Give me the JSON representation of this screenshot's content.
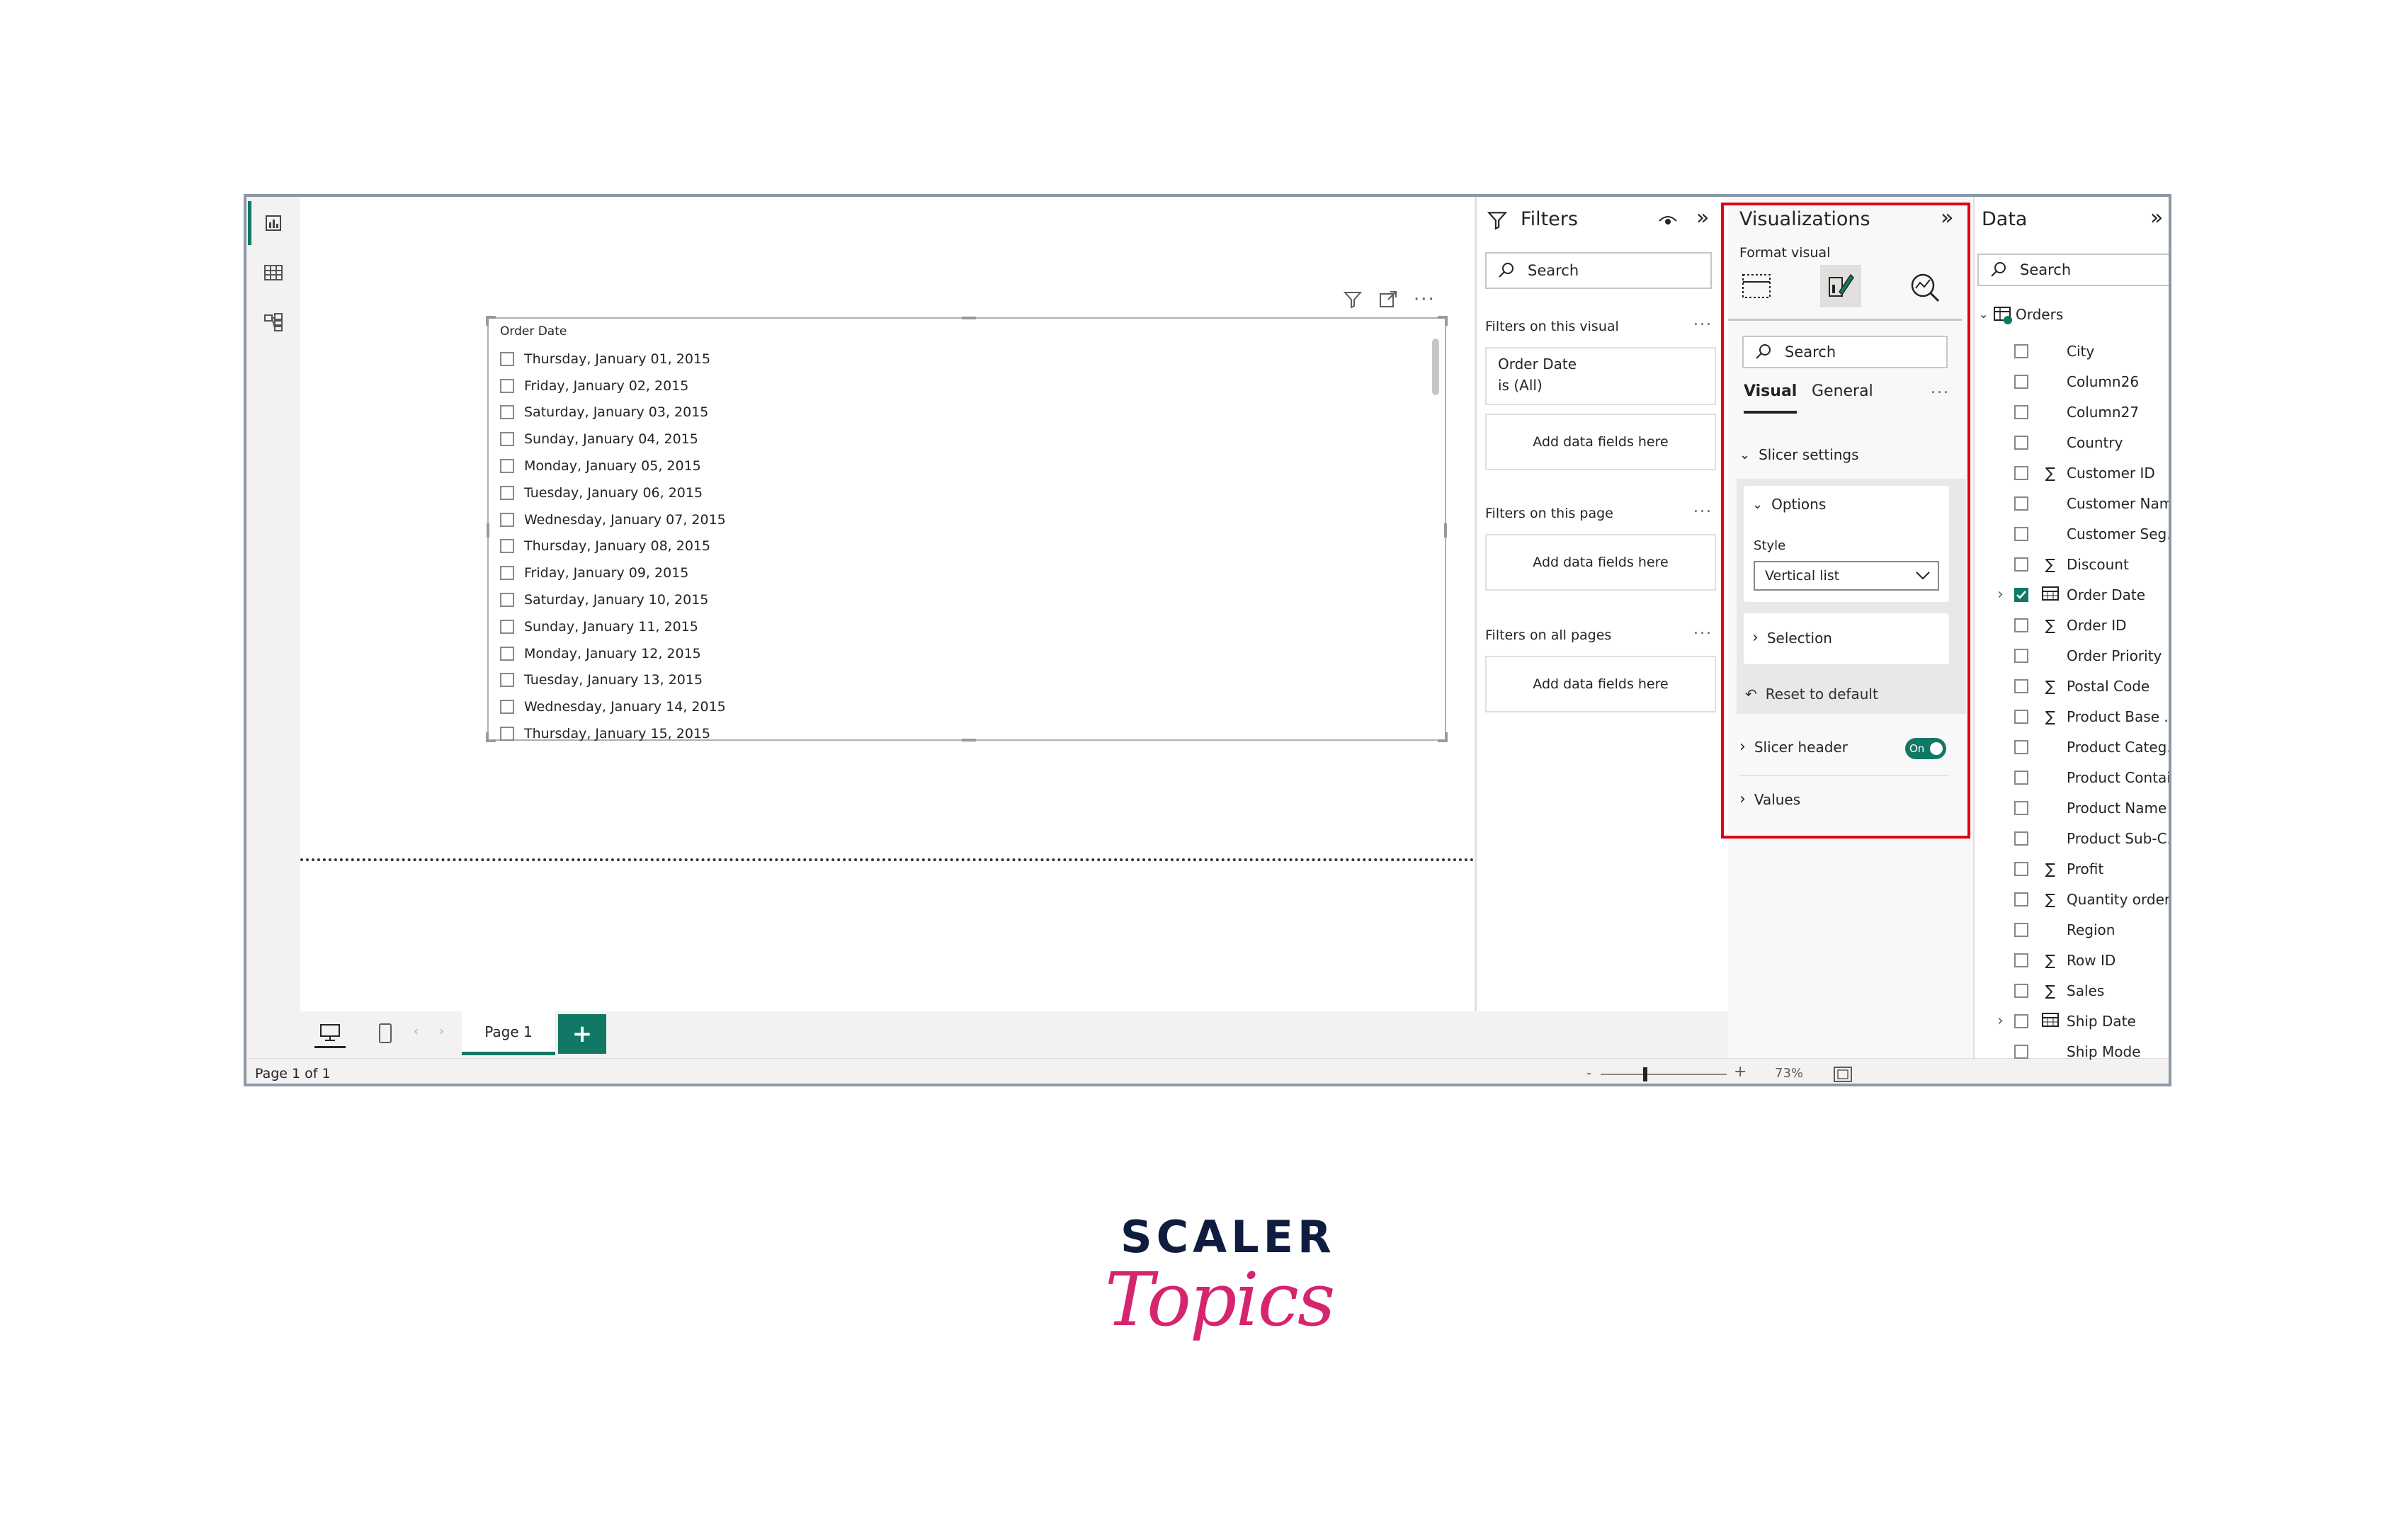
{
  "left_rail": {
    "items": [
      {
        "icon": "report-view-icon"
      },
      {
        "icon": "table-view-icon"
      },
      {
        "icon": "model-view-icon"
      }
    ]
  },
  "slicer": {
    "title": "Order Date",
    "items": [
      "Thursday, January 01, 2015",
      "Friday, January 02, 2015",
      "Saturday, January 03, 2015",
      "Sunday, January 04, 2015",
      "Monday, January 05, 2015",
      "Tuesday, January 06, 2015",
      "Wednesday, January 07, 2015",
      "Thursday, January 08, 2015",
      "Friday, January 09, 2015",
      "Saturday, January 10, 2015",
      "Sunday, January 11, 2015",
      "Monday, January 12, 2015",
      "Tuesday, January 13, 2015",
      "Wednesday, January 14, 2015",
      "Thursday, January 15, 2015"
    ]
  },
  "page_tabs": {
    "page_label": "Page 1",
    "add_label": "+"
  },
  "status_bar": {
    "page_count": "Page 1 of 1",
    "zoom_minus": "-",
    "zoom_plus": "+",
    "zoom_value": "73%"
  },
  "filters": {
    "title": "Filters",
    "search_placeholder": "Search",
    "on_this_visual": "Filters on this visual",
    "order_date_filter_title": "Order Date",
    "order_date_filter_value": "is (All)",
    "add_data_fields": "Add data fields here",
    "on_this_page": "Filters on this page",
    "on_all_pages": "Filters on all pages",
    "more": "..."
  },
  "visualizations": {
    "title": "Visualizations",
    "format_visual": "Format visual",
    "search_placeholder": "Search",
    "tab_visual": "Visual",
    "tab_general": "General",
    "more": "...",
    "slicer_settings": "Slicer settings",
    "options": "Options",
    "style_label": "Style",
    "style_value": "Vertical list",
    "selection": "Selection",
    "reset_to_default": "Reset to default",
    "slicer_header": "Slicer header",
    "toggle_on": "On",
    "values": "Values"
  },
  "data": {
    "title": "Data",
    "search_placeholder": "Search",
    "table_name": "Orders",
    "fields": [
      {
        "name": "City",
        "icon": "",
        "checked": false,
        "expand": false
      },
      {
        "name": "Column26",
        "icon": "",
        "checked": false,
        "expand": false
      },
      {
        "name": "Column27",
        "icon": "",
        "checked": false,
        "expand": false
      },
      {
        "name": "Country",
        "icon": "",
        "checked": false,
        "expand": false
      },
      {
        "name": "Customer ID",
        "icon": "∑",
        "checked": false,
        "expand": false
      },
      {
        "name": "Customer Name",
        "icon": "",
        "checked": false,
        "expand": false
      },
      {
        "name": "Customer Seg...",
        "icon": "",
        "checked": false,
        "expand": false
      },
      {
        "name": "Discount",
        "icon": "∑",
        "checked": false,
        "expand": false
      },
      {
        "name": "Order Date",
        "icon": "calendar",
        "checked": true,
        "expand": true
      },
      {
        "name": "Order ID",
        "icon": "∑",
        "checked": false,
        "expand": false
      },
      {
        "name": "Order Priority",
        "icon": "",
        "checked": false,
        "expand": false
      },
      {
        "name": "Postal Code",
        "icon": "∑",
        "checked": false,
        "expand": false
      },
      {
        "name": "Product Base ...",
        "icon": "∑",
        "checked": false,
        "expand": false
      },
      {
        "name": "Product Categ...",
        "icon": "",
        "checked": false,
        "expand": false
      },
      {
        "name": "Product Contai...",
        "icon": "",
        "checked": false,
        "expand": false
      },
      {
        "name": "Product Name",
        "icon": "",
        "checked": false,
        "expand": false
      },
      {
        "name": "Product Sub-C...",
        "icon": "",
        "checked": false,
        "expand": false
      },
      {
        "name": "Profit",
        "icon": "∑",
        "checked": false,
        "expand": false
      },
      {
        "name": "Quantity order...",
        "icon": "∑",
        "checked": false,
        "expand": false
      },
      {
        "name": "Region",
        "icon": "",
        "checked": false,
        "expand": false
      },
      {
        "name": "Row ID",
        "icon": "∑",
        "checked": false,
        "expand": false
      },
      {
        "name": "Sales",
        "icon": "∑",
        "checked": false,
        "expand": false
      },
      {
        "name": "Ship Date",
        "icon": "calendar",
        "checked": false,
        "expand": true
      },
      {
        "name": "Ship Mode",
        "icon": "",
        "checked": false,
        "expand": false
      }
    ]
  },
  "logo": {
    "line1": "SCALER",
    "line2": "Topics"
  },
  "colors": {
    "accent": "#117865",
    "highlight": "#e00012",
    "logo_navy": "#0f1c3f",
    "logo_pink": "#d6246e"
  }
}
